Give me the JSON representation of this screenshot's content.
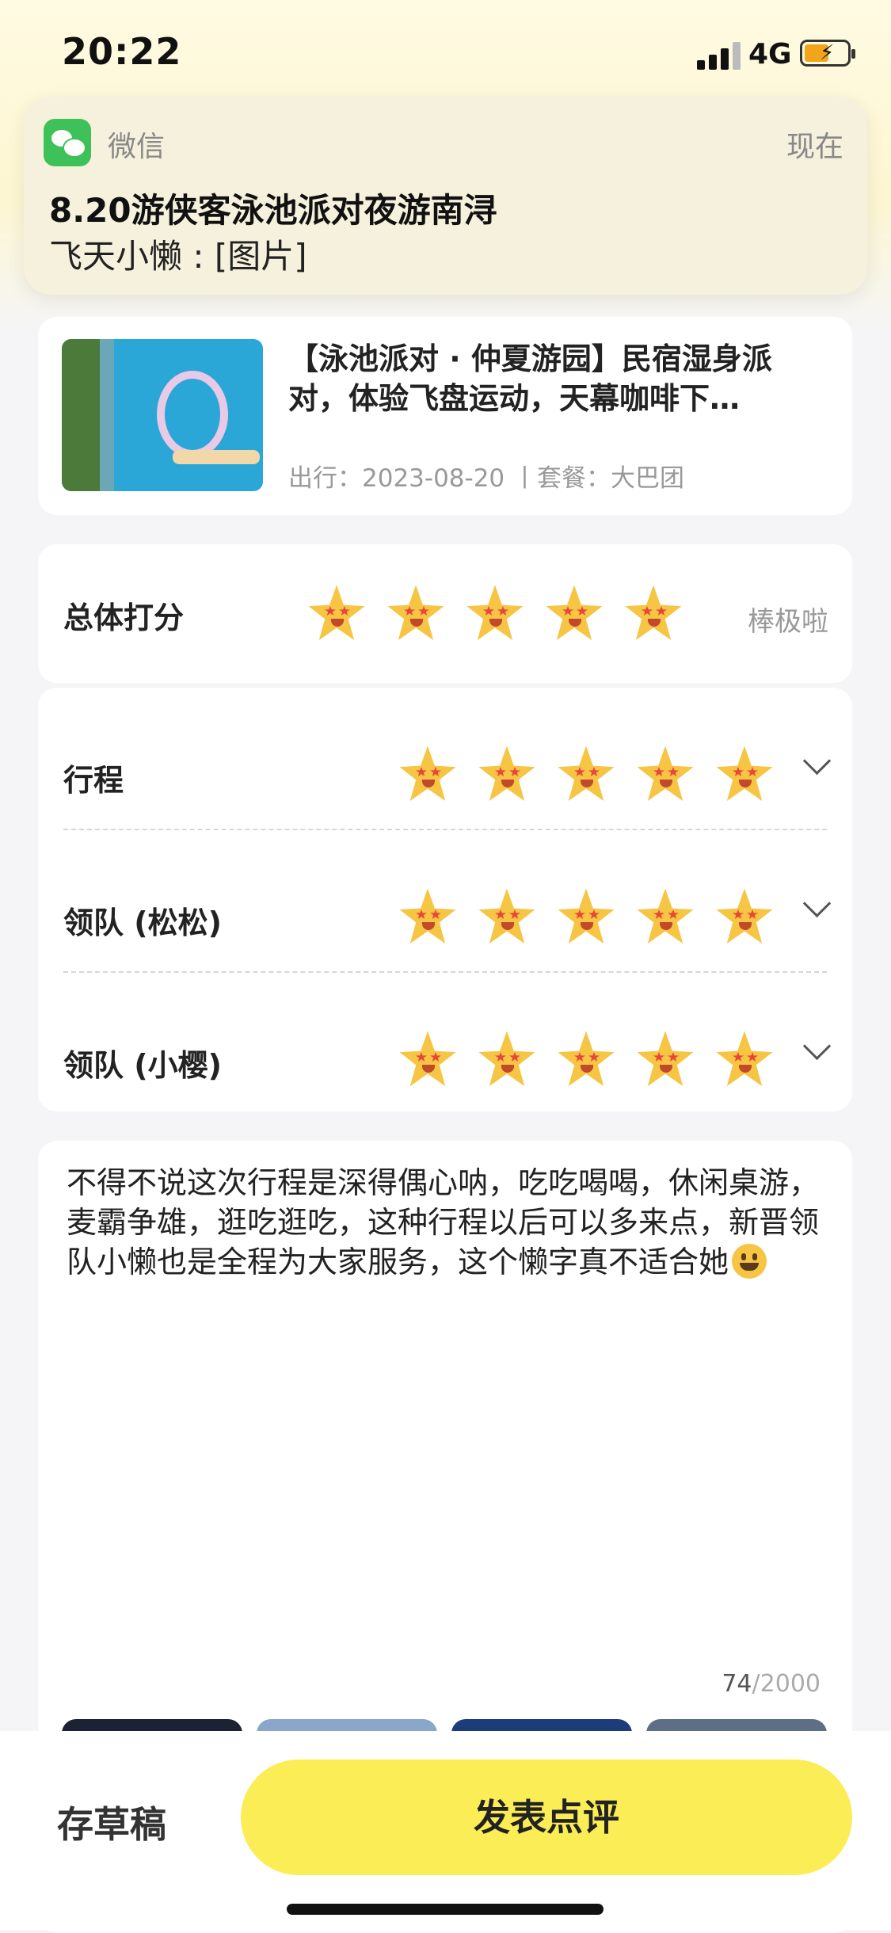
{
  "status_bar": {
    "time": "20:22",
    "network": "4G"
  },
  "notification": {
    "app": "微信",
    "time": "现在",
    "title": "8.20游侠客泳池派对夜游南浔",
    "body": "飞天小懒 : [图片]"
  },
  "product": {
    "title": "【泳池派对 · 仲夏游园】民宿湿身派对，体验飞盘运动，天幕咖啡下…",
    "meta": "出行：2023-08-20 丨套餐：大巴团"
  },
  "ratings": {
    "overall": {
      "label": "总体打分",
      "stars": 5,
      "text": "棒极啦"
    },
    "items": [
      {
        "label": "行程",
        "stars": 5
      },
      {
        "label": "领队 (松松)",
        "stars": 5
      },
      {
        "label": "领队 (小樱)",
        "stars": 5
      }
    ]
  },
  "review": {
    "text": "不得不说这次行程是深得偶心呐，吃吃喝喝，休闲桌游，麦霸争雄，逛吃逛吃，这种行程以后可以多来点，新晋领队小懒也是全程为大家服务，这个懒字真不适合她",
    "count_current": "74",
    "count_max": "/2000"
  },
  "bottom": {
    "draft_label": "存草稿",
    "publish_label": "发表点评"
  },
  "colors": {
    "accent_yellow": "#fbed56",
    "star": "#f7c544",
    "wechat_green": "#3fc15a"
  }
}
